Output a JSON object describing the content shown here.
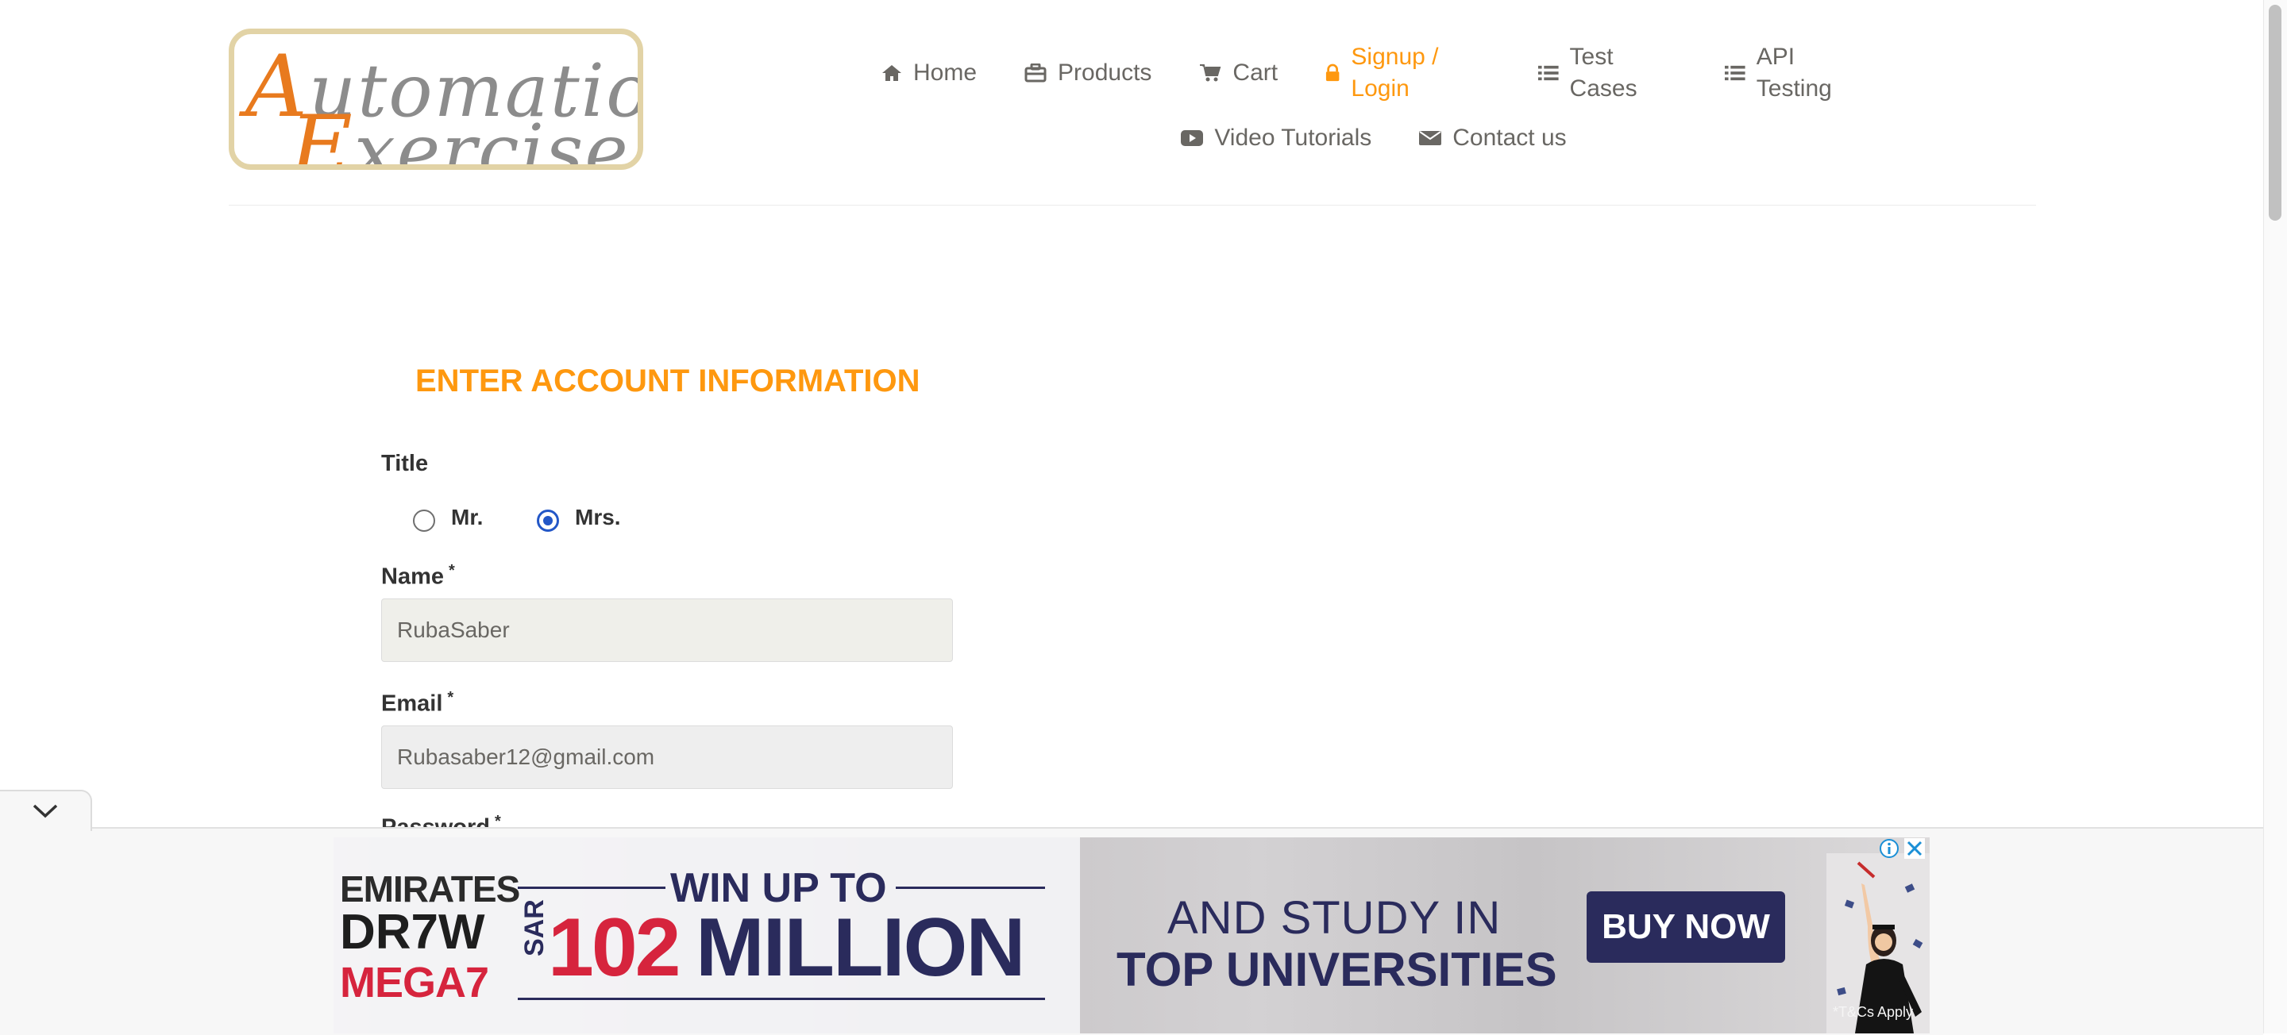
{
  "header": {
    "logo": {
      "line1_initial": "A",
      "line1_rest": "utomation",
      "line2_initial": "E",
      "line2_rest": "xercise"
    },
    "nav": [
      {
        "label": "Home",
        "icon": "home-icon"
      },
      {
        "label": "Products",
        "icon": "briefcase-icon"
      },
      {
        "label": "Cart",
        "icon": "cart-icon"
      },
      {
        "label": "Signup / Login",
        "icon": "lock-icon",
        "active": true
      },
      {
        "label": "Test Cases",
        "icon": "list-icon"
      },
      {
        "label": "API Testing",
        "icon": "list-icon"
      },
      {
        "label": "Video Tutorials",
        "icon": "youtube-play-icon"
      },
      {
        "label": "Contact us",
        "icon": "envelope-icon"
      }
    ]
  },
  "form": {
    "heading": "ENTER ACCOUNT INFORMATION",
    "title_label": "Title",
    "title_options": [
      {
        "label": "Mr.",
        "checked": false
      },
      {
        "label": "Mrs.",
        "checked": true
      }
    ],
    "name_label": "Name",
    "name_value": "RubaSaber",
    "email_label": "Email",
    "email_value": "Rubasaber12@gmail.com",
    "password_label": "Password",
    "required_mark": "*"
  },
  "ad": {
    "brand_line1": "EMIRATES",
    "brand_line2": "DR7W",
    "brand_line3": "MEGA7",
    "headline": "WIN UP TO",
    "currency": "SAR",
    "amount": "102",
    "amount_unit": "MILLION",
    "tagline_1": "AND STUDY IN",
    "tagline_2": "TOP UNIVERSITIES",
    "cta": "BUY NOW",
    "terms": "*T&Cs Apply"
  },
  "colors": {
    "accent": "#fe980f",
    "ad_navy": "#2a2b5c",
    "ad_red": "#d6243d",
    "radio_checked": "#2357c7"
  }
}
